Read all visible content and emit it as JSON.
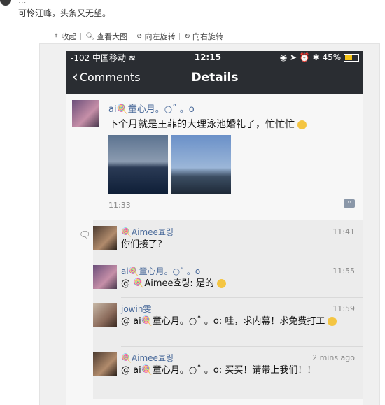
{
  "article": {
    "line1": "...",
    "line2": "可怜汪峰，头条又无望。"
  },
  "toolbar": {
    "collapse": "收起",
    "view_large": "查看大图",
    "rotate_left": "向左旋转",
    "rotate_right": "向右旋转"
  },
  "status_bar": {
    "carrier": "-102 中国移动",
    "time": "12:15",
    "battery": "45%"
  },
  "nav": {
    "back_label": "Comments",
    "title": "Details"
  },
  "post": {
    "author": "ai🍭童心月。○˚ 。o",
    "text": "下个月就是王菲的大理泳池婚礼了，忙忙忙",
    "time": "11:33"
  },
  "comments": [
    {
      "author": "🍭Aimee효링",
      "time": "11:41",
      "text": "你们接了?"
    },
    {
      "author": "ai🍭童心月。○˚ 。o",
      "time": "11:55",
      "text": "@ 🍭Aimee효링: 是的"
    },
    {
      "author": "jowin雯",
      "time": "11:59",
      "text": "@ ai🍭童心月。○˚ 。o: 哇，求内幕！求免费打工"
    },
    {
      "author": "🍭Aimee효링",
      "time": "2 mins ago",
      "text": "@ ai🍭童心月。○˚ 。o: 买买！请带上我们！！"
    }
  ]
}
